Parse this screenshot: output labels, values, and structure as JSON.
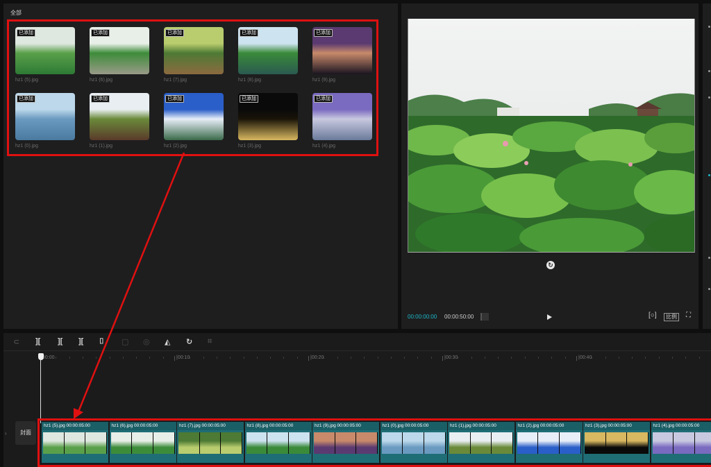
{
  "media_panel": {
    "title": "全部",
    "added_badge": "已添加",
    "items": [
      {
        "name": "hz1 (5).jpg",
        "colors": [
          "#dfe8e0",
          "#5aa04a",
          "#2d7a35"
        ]
      },
      {
        "name": "hz1 (6).jpg",
        "colors": [
          "#e8efe8",
          "#3d8c3a",
          "#9a9a88"
        ]
      },
      {
        "name": "hz1 (7).jpg",
        "colors": [
          "#b9cc6e",
          "#4d7a34",
          "#8c6a40"
        ]
      },
      {
        "name": "hz1 (8).jpg",
        "colors": [
          "#cde3ef",
          "#3a8a3a",
          "#2a5a50"
        ]
      },
      {
        "name": "hz1 (9).jpg",
        "colors": [
          "#5a3a70",
          "#c88a6a",
          "#1a1420"
        ]
      },
      {
        "name": "hz1 (0).jpg",
        "colors": [
          "#bcd8ea",
          "#6a9ac0",
          "#4a7aa0"
        ]
      },
      {
        "name": "hz1 (1).jpg",
        "colors": [
          "#e9eef2",
          "#6a8a3a",
          "#5a3a2a"
        ]
      },
      {
        "name": "hz1 (2).jpg",
        "colors": [
          "#2a5ec8",
          "#e8eef8",
          "#3a6a4a"
        ]
      },
      {
        "name": "hz1 (3).jpg",
        "colors": [
          "#0a0a0a",
          "#1a1408",
          "#d8b860"
        ]
      },
      {
        "name": "hz1 (4).jpg",
        "colors": [
          "#7a6ac0",
          "#c8c8e0",
          "#6a7a9a"
        ]
      }
    ]
  },
  "player": {
    "current_time": "00:00:00:00",
    "total_time": "00:00:50:00",
    "ratio_label": "比例",
    "play_icon": "play-icon",
    "rotate_icon": "rotate-icon",
    "fullscreen_icon": "fullscreen-icon",
    "fit_icon": "fit-icon"
  },
  "timeline": {
    "ruler_labels": [
      "00:00",
      "|00:10",
      "|00:20",
      "|00:30",
      "|00:40"
    ],
    "cover_label": "封面",
    "clips": [
      {
        "label": "hz1 (5).jpg  00:00:05:00",
        "colors": [
          "#5aa04a",
          "#dfe8e0"
        ]
      },
      {
        "label": "hz1 (6).jpg  00:00:05:00",
        "colors": [
          "#3d8c3a",
          "#e8efe8"
        ]
      },
      {
        "label": "hz1 (7).jpg  00:00:05:00",
        "colors": [
          "#b9cc6e",
          "#4d7a34"
        ]
      },
      {
        "label": "hz1 (8).jpg  00:00:05:00",
        "colors": [
          "#3a8a3a",
          "#cde3ef"
        ]
      },
      {
        "label": "hz1 (9).jpg  00:00:05:00",
        "colors": [
          "#5a3a70",
          "#c88a6a"
        ]
      },
      {
        "label": "hz1 (0).jpg  00:00:05:00",
        "colors": [
          "#6a9ac0",
          "#bcd8ea"
        ]
      },
      {
        "label": "hz1 (1).jpg  00:00:05:00",
        "colors": [
          "#6a8a3a",
          "#e9eef2"
        ]
      },
      {
        "label": "hz1 (2).jpg  00:00:05:00",
        "colors": [
          "#2a5ec8",
          "#e8eef8"
        ]
      },
      {
        "label": "hz1 (3).jpg  00:00:05:00",
        "colors": [
          "#0a0a0a",
          "#d8b860"
        ]
      },
      {
        "label": "hz1 (4).jpg  00:00:05:00",
        "colors": [
          "#7a6ac0",
          "#c8c8e0"
        ]
      }
    ]
  },
  "colors": {
    "accent_red": "#e01010",
    "timecode_cyan": "#1cb8c8",
    "clip_teal": "#1f6d75"
  }
}
